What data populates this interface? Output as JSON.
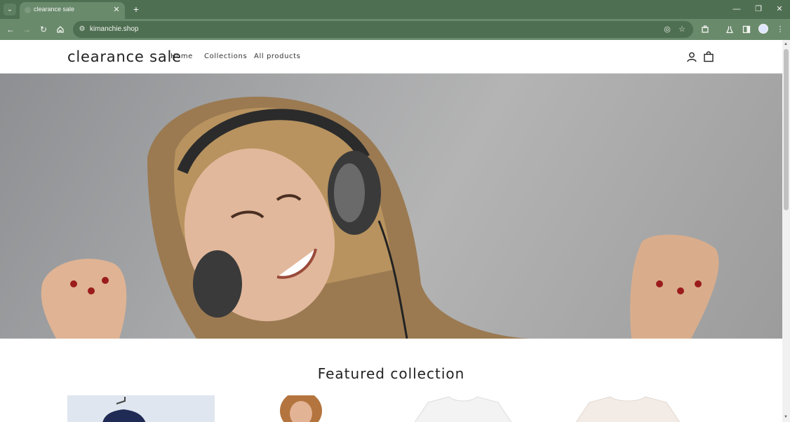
{
  "browser": {
    "tab_title": "clearance sale",
    "url": "kimanchie.shop",
    "icons": {
      "tab_menu": "chevron-down-icon",
      "close": "close-icon",
      "new_tab": "plus-icon",
      "back": "back-arrow-icon",
      "forward": "forward-arrow-icon",
      "reload": "reload-icon",
      "home": "home-icon",
      "site_info": "site-settings-icon",
      "eye": "eye-off-icon",
      "bookmark": "star-icon",
      "extensions": "puzzle-icon",
      "labs": "flask-icon",
      "sidepanel": "side-panel-icon",
      "menu": "kebab-menu-icon"
    }
  },
  "store": {
    "logo": "clearance sale",
    "nav": [
      "Home",
      "Collections",
      "All products"
    ],
    "icons": {
      "account": "account-icon",
      "cart": "shopping-bag-icon"
    }
  },
  "featured": {
    "title": "Featured collection"
  },
  "colors": {
    "chrome_dark": "#4f6f52",
    "chrome_light": "#6a8a6c",
    "text": "#222222"
  }
}
